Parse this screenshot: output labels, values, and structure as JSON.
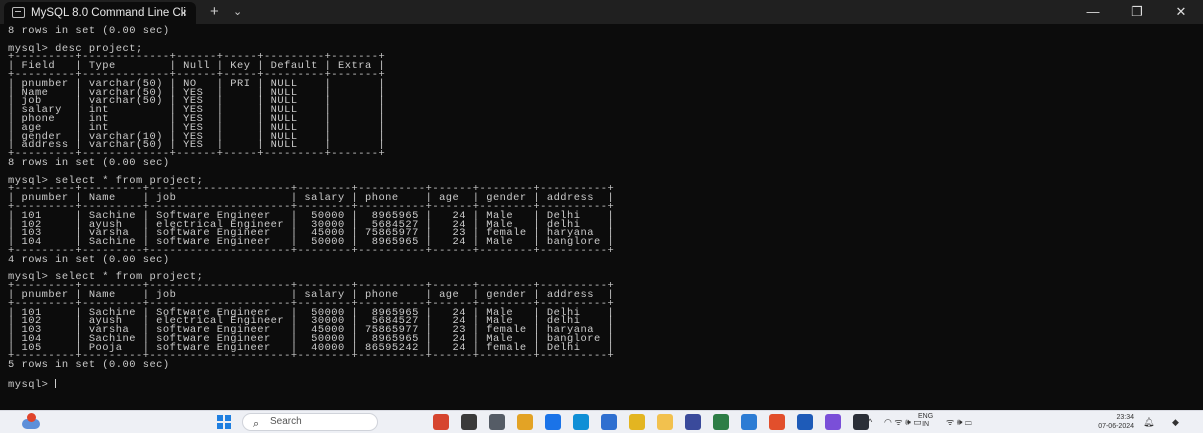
{
  "window": {
    "tab_title": "MySQL 8.0 Command Line Cli",
    "tab_close": "×",
    "new_tab": "+",
    "tab_menu": "⌄",
    "minimize": "—",
    "maximize": "❐",
    "close": "✕"
  },
  "terminal": {
    "prompt": "mysql> ",
    "lines": [
      "8 rows in set (0.00 sec)",
      "",
      "mysql> desc project;",
      "+---------+-------------+------+-----+---------+-------+",
      "| Field   | Type        | Null | Key | Default | Extra |",
      "+---------+-------------+------+-----+---------+-------+",
      "| pnumber | varchar(50) | NO   | PRI | NULL    |       |",
      "| Name    | varchar(50) | YES  |     | NULL    |       |",
      "| job     | varchar(50) | YES  |     | NULL    |       |",
      "| salary  | int         | YES  |     | NULL    |       |",
      "| phone   | int         | YES  |     | NULL    |       |",
      "| age     | int         | YES  |     | NULL    |       |",
      "| gender  | varchar(10) | YES  |     | NULL    |       |",
      "| address | varchar(50) | YES  |     | NULL    |       |",
      "+---------+-------------+------+-----+---------+-------+",
      "8 rows in set (0.00 sec)",
      "",
      "mysql> select * from project;",
      "+---------+---------+---------------------+--------+----------+------+--------+----------+",
      "| pnumber | Name    | job                 | salary | phone    | age  | gender | address  |",
      "+---------+---------+---------------------+--------+----------+------+--------+----------+",
      "| 101     | Sachine | Software Engineer   |  50000 |  8965965 |   24 | Male   | Delhi    |",
      "| 102     | ayush   | electrical Engineer |  30000 |  5684527 |   24 | Male   | delhi    |",
      "| 103     | varsha  | software Engineer   |  45000 | 75865977 |   23 | female | haryana  |",
      "| 104     | Sachine | software Engineer   |  50000 |  8965965 |   24 | Male   | banglore |",
      "+---------+---------+---------------------+--------+----------+------+--------+----------+",
      "4 rows in set (0.00 sec)",
      "",
      "mysql> select * from project;",
      "+---------+---------+---------------------+--------+----------+------+--------+----------+",
      "| pnumber | Name    | job                 | salary | phone    | age  | gender | address  |",
      "+---------+---------+---------------------+--------+----------+------+--------+----------+",
      "| 101     | Sachine | Software Engineer   |  50000 |  8965965 |   24 | Male   | Delhi    |",
      "| 102     | ayush   | electrical Engineer |  30000 |  5684527 |   24 | Male   | delhi    |",
      "| 103     | varsha  | software Engineer   |  45000 | 75865977 |   23 | female | haryana  |",
      "| 104     | Sachine | software Engineer   |  50000 |  8965965 |   24 | Male   | banglore |",
      "| 105     | Pooja   | software Engineer   |  40000 | 86595242 |   24 | female | Delhi    |",
      "+---------+---------+---------------------+--------+----------+------+--------+----------+",
      "5 rows in set (0.00 sec)",
      ""
    ]
  },
  "taskbar": {
    "search_placeholder": "Search",
    "lang_top": "ENG",
    "lang_bottom": "IN",
    "time": "23:34",
    "date": "07-06-2024",
    "tray_chevron": "^",
    "tray_icons": "◠   ᯤ 🕪 ▭"
  },
  "colors": {
    "terminal_bg": "#0c0c0c",
    "terminal_fg": "#cccccc",
    "titlebar_bg": "#202020",
    "taskbar_bg": "#eef0f5"
  },
  "taskbar_apps": [
    "media-player-icon",
    "files-icon",
    "store-icon",
    "settings-icon",
    "chrome-icon",
    "edge-icon",
    "browser-icon",
    "file-explorer-icon",
    "folder-icon",
    "terminal-app-icon",
    "notes-icon",
    "vscode-icon",
    "office-icon",
    "word-icon",
    "copilot-icon",
    "mysql-terminal-icon"
  ]
}
